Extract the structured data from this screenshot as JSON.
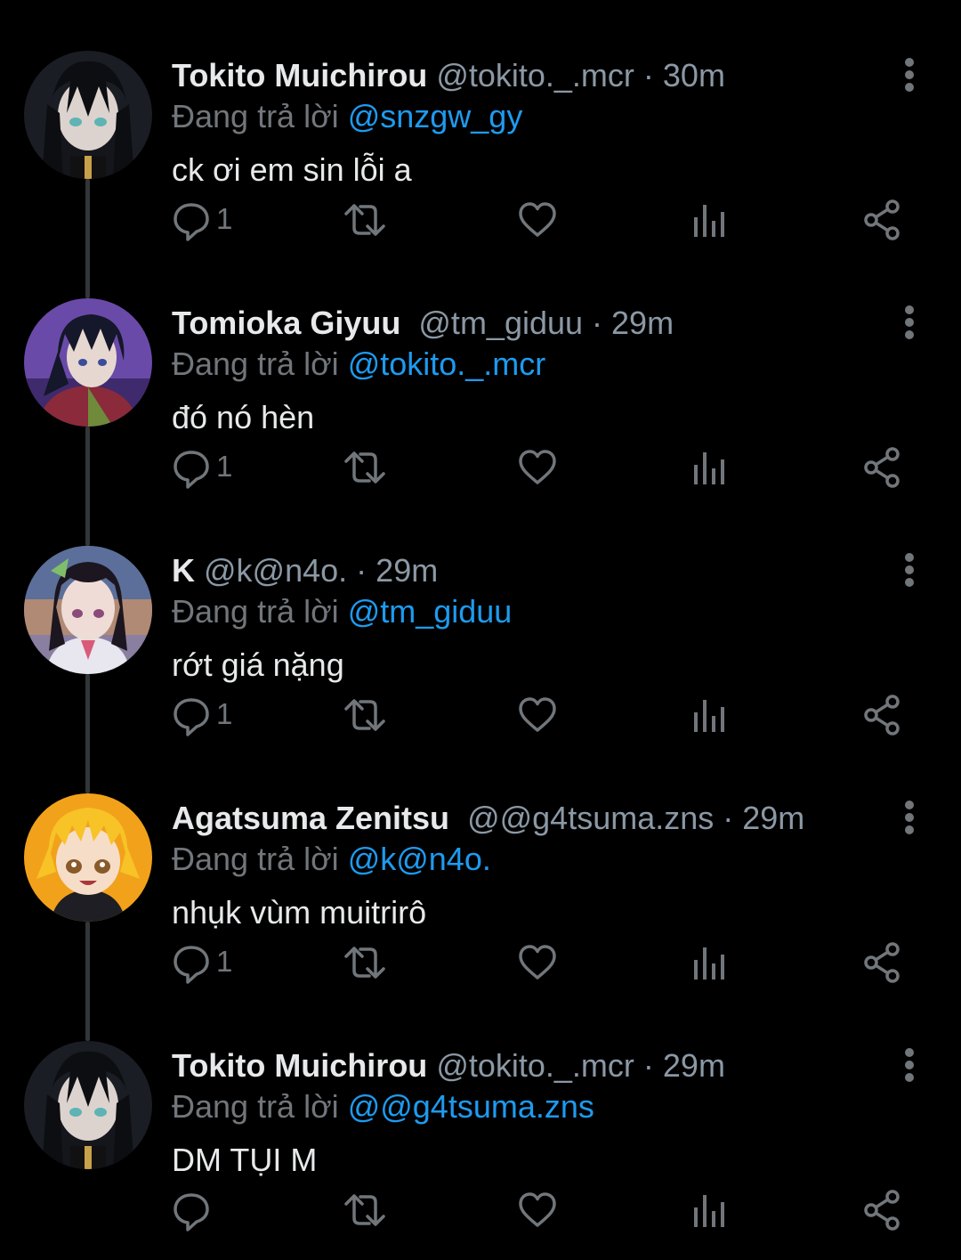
{
  "theme": {
    "background": "#000000",
    "text": "#e7e9ea",
    "secondary": "#71767b",
    "link": "#1d9bf0",
    "connector": "#333639"
  },
  "tweets": [
    {
      "name": "Tokito Muichirou",
      "handle": "@tokito._.mcr",
      "dot": " · ",
      "time": "30m",
      "reply_label": "Đang trả lời ",
      "reply_to": "@snzgw_gy",
      "text": "ck ơi em sin lỗi a",
      "reply_count": "1",
      "avatar": "tokito"
    },
    {
      "name": "Tomioka Giyuu",
      "handle": "@tm_giduu",
      "dot": " · ",
      "time": "29m",
      "reply_label": "Đang trả lời ",
      "reply_to": "@tokito._.mcr",
      "text": "đó nó hèn",
      "reply_count": "1",
      "avatar": "giyuu"
    },
    {
      "name": "K",
      "handle": "@k@n4o.",
      "dot": " · ",
      "time": "29m",
      "reply_label": "Đang trả lời ",
      "reply_to": "@tm_giduu",
      "text": "rớt giá nặng",
      "reply_count": "1",
      "avatar": "kanao"
    },
    {
      "name": "Agatsuma Zenitsu",
      "handle": "@@g4tsuma.zns",
      "dot": " · ",
      "time": "29m",
      "reply_label": "Đang trả lời ",
      "reply_to": "@k@n4o.",
      "text": "nhụk vùm muitrirô",
      "reply_count": "1",
      "avatar": "zenitsu"
    },
    {
      "name": "Tokito Muichirou",
      "handle": "@tokito._.mcr",
      "dot": " · ",
      "time": "29m",
      "reply_label": "Đang trả lời ",
      "reply_to": "@@g4tsuma.zns",
      "text": "DM TỤI M",
      "reply_count": "",
      "avatar": "tokito"
    }
  ]
}
